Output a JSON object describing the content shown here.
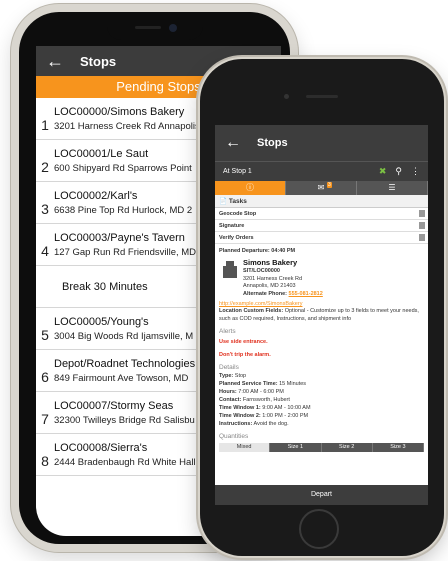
{
  "back_phone": {
    "header": {
      "back_icon": "←",
      "title": "Stops"
    },
    "pending_label": "Pending Stops",
    "stops": [
      {
        "number": "1",
        "name": "LOC00000/Simons Bakery",
        "address": "3201 Harness Creek Rd Annapolis"
      },
      {
        "number": "2",
        "name": "LOC00001/Le Saut",
        "address": "600 Shipyard Rd Sparrows Point"
      },
      {
        "number": "3",
        "name": "LOC00002/Karl's",
        "address": "6638 Pine Top Rd Hurlock, MD 2"
      },
      {
        "number": "4",
        "name": "LOC00003/Payne's Tavern",
        "address": "127 Gap Run Rd Friendsville, MD"
      }
    ],
    "break_label": "Break 30 Minutes",
    "stops_after_break": [
      {
        "number": "5",
        "name": "LOC00005/Young's",
        "address": "3004 Big Woods Rd Ijamsville, M"
      },
      {
        "number": "6",
        "name": "Depot/Roadnet Technologies",
        "address": "849 Fairmount Ave Towson, MD"
      },
      {
        "number": "7",
        "name": "LOC00007/Stormy Seas",
        "address": "32300 Twilleys Bridge Rd Salisbu"
      },
      {
        "number": "8",
        "name": "LOC00008/Sierra's",
        "address": "2444 Bradenbaugh Rd White Hall"
      }
    ]
  },
  "front_phone": {
    "header": {
      "back_icon": "←",
      "title": "Stops"
    },
    "subheader": {
      "label": "At Stop 1",
      "route_icon": "route-icon",
      "search_icon": "🔍",
      "menu_icon": "⋮"
    },
    "tabs": [
      {
        "label": "ⓘ",
        "active": true
      },
      {
        "label": "✉",
        "badge": "3",
        "active": false
      },
      {
        "label": "☰",
        "active": false
      }
    ],
    "tasks_label": "Tasks",
    "tasks": [
      "Geocode Stop",
      "Signature",
      "Verify Orders"
    ],
    "planned_departure": "Planned Departure: 04:40 PM",
    "stop": {
      "name": "Simons Bakery",
      "id": "SIT/LOC00000",
      "address_line1": "3201 Harness Creek Rd",
      "address_line2": "Annapolis, MD 21403",
      "alt_phone_label": "Alternate Phone: ",
      "alt_phone": "555-081-2812"
    },
    "link": "http://example.com/SimonsBakery",
    "custom_fields_label": "Location Custom Fields:",
    "custom_fields_text": "Optional - Customize up to 3 fields to meet your needs, such as COD required, Instructions, and shipment info",
    "alerts_label": "Alerts",
    "alerts": [
      "Use side entrance.",
      "Don't trip the alarm."
    ],
    "details_label": "Details",
    "details": [
      {
        "k": "Type:",
        "v": "Stop"
      },
      {
        "k": "Planned Service Time:",
        "v": "15 Minutes"
      },
      {
        "k": "Hours:",
        "v": "7:00 AM - 6:00 PM"
      },
      {
        "k": "Contact:",
        "v": "Farnsworth, Hubert"
      },
      {
        "k": "Time Window 1:",
        "v": "9:00 AM - 10:00 AM"
      },
      {
        "k": "Time Window 2:",
        "v": "1:00 PM - 2:00 PM"
      },
      {
        "k": "Instructions:",
        "v": "Avoid the dog."
      }
    ],
    "quantities_label": "Quantities",
    "quantities": [
      "Mixed",
      "Size 1",
      "Size 2",
      "Size 3"
    ],
    "depart_label": "Depart"
  },
  "colors": {
    "accent": "#f7941d",
    "header": "#3d3d3d",
    "alert": "#e0301e"
  }
}
